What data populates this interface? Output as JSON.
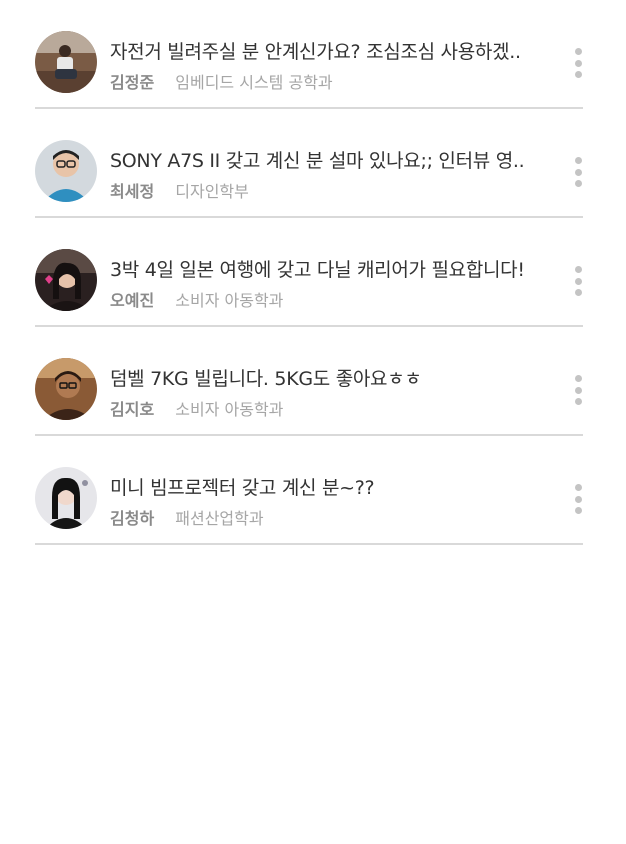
{
  "posts": [
    {
      "title": "자전거 빌려주실 분 안계신가요? 조심조심 사용하겠..",
      "author": "김정준",
      "department": "임베디드 시스템 공학과",
      "avatar_icon": "avatar-photo-cyclist",
      "avatar_colors": [
        "#8a6a52",
        "#3a2f2a"
      ]
    },
    {
      "title": "SONY A7S II 갖고 계신 분 설마 있나요;; 인터뷰 영..",
      "author": "최세정",
      "department": "디자인학부",
      "avatar_icon": "avatar-photo-man-glasses",
      "avatar_colors": [
        "#cfd6dc",
        "#2f8fc0"
      ]
    },
    {
      "title": "3박 4일 일본 여행에 갖고 다닐 캐리어가 필요합니다!",
      "author": "오예진",
      "department": "소비자 아동학과",
      "avatar_icon": "avatar-photo-woman-heart",
      "avatar_colors": [
        "#4a3a36",
        "#1c1616"
      ]
    },
    {
      "title": "덤벨 7KG 빌립니다. 5KG도 좋아요ㅎㅎ",
      "author": "김지호",
      "department": "소비자 아동학과",
      "avatar_icon": "avatar-photo-man-cafe",
      "avatar_colors": [
        "#a0704a",
        "#3b2418"
      ]
    },
    {
      "title": "미니 빔프로젝터 갖고 계신 분~??",
      "author": "김청하",
      "department": "패션산업학과",
      "avatar_icon": "avatar-photo-woman-dark",
      "avatar_colors": [
        "#e4e4e8",
        "#141414"
      ]
    }
  ],
  "more_icon": "more-vertical-icon"
}
